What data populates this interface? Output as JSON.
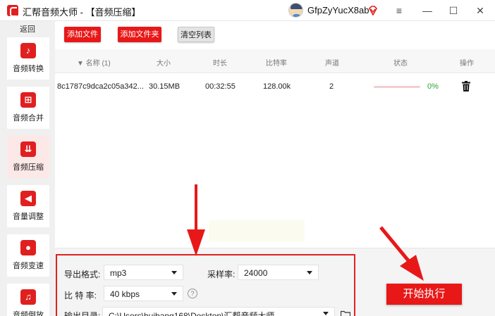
{
  "window": {
    "title": "汇帮音频大师 - 【音频压缩】",
    "username": "GfpZyYucX8ab",
    "minimize_symbol": "≡",
    "min_symbol": "—",
    "max_symbol": "☐",
    "close_symbol": "✕"
  },
  "sidebar": {
    "back_label": "返回",
    "items": [
      {
        "label": "音频转换",
        "icon": "convert-icon",
        "glyph": "♪"
      },
      {
        "label": "音频合并",
        "icon": "merge-icon",
        "glyph": "⊞"
      },
      {
        "label": "音频压缩",
        "icon": "compress-icon",
        "glyph": "⇊"
      },
      {
        "label": "音量调整",
        "icon": "volume-icon",
        "glyph": "◀"
      },
      {
        "label": "音频变速",
        "icon": "microphone-icon",
        "glyph": "●"
      },
      {
        "label": "音频倒放",
        "icon": "music-note-icon",
        "glyph": "♫"
      }
    ],
    "active_index": 2
  },
  "toolbar": {
    "add_file_label": "添加文件",
    "add_folder_label": "添加文件夹",
    "clear_list_label": "清空列表"
  },
  "table": {
    "columns": {
      "name": "▼ 名称 (1)",
      "size": "大小",
      "duration": "时长",
      "bitrate": "比特率",
      "channels": "声道",
      "status": "状态",
      "action": "操作"
    },
    "rows": [
      {
        "name": "8c1787c9dca2c05a342...",
        "size": "30.15MB",
        "duration": "00:32:55",
        "bitrate": "128.00k",
        "channels": "2",
        "progress": 0,
        "progress_label": "0%"
      }
    ]
  },
  "settings": {
    "format_label": "导出格式:",
    "format_value": "mp3",
    "sample_rate_label": "采样率:",
    "sample_rate_value": "24000",
    "bitrate_label": "比 特 率:",
    "bitrate_value": "40 kbps",
    "output_label": "输出目录:",
    "output_value": "C:\\Users\\huibang168\\Desktop\\汇帮音频大师",
    "help_symbol": "?"
  },
  "start_button_label": "开始执行",
  "colors": {
    "accent_red": "#e81818",
    "progress_green": "#2fa32f"
  }
}
